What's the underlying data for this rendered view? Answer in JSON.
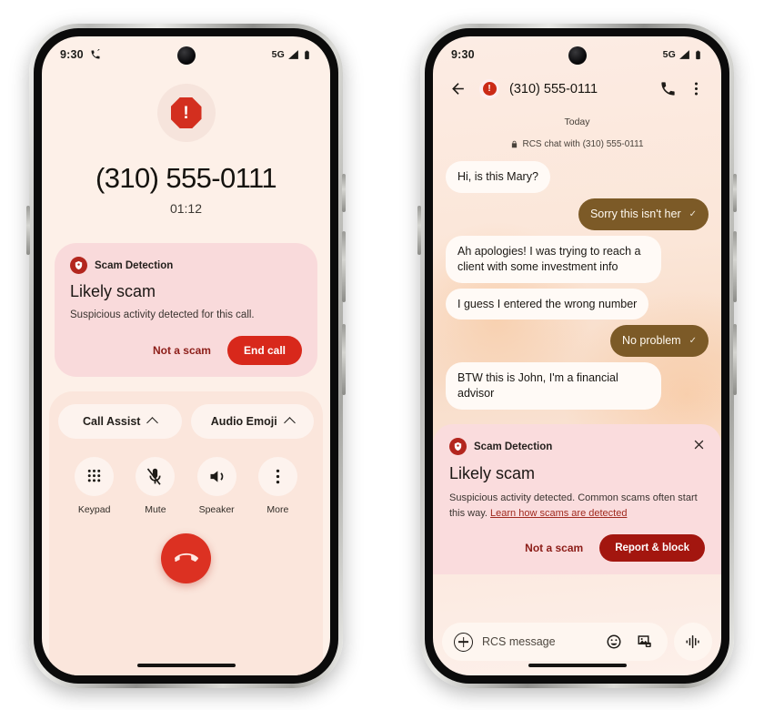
{
  "call_phone": {
    "status_bar": {
      "time": "9:30",
      "call_icon": "phone-active-icon",
      "network": "5G",
      "signal_icon": "signal-bars-icon",
      "battery_icon": "battery-icon"
    },
    "alert_icon": "octagon-alert-icon",
    "alert_glyph": "!",
    "caller_number": "(310) 555-0111",
    "call_duration": "01:12",
    "scam_card": {
      "shield_icon": "shield-scam-icon",
      "header": "Scam Detection",
      "title": "Likely scam",
      "body": "Suspicious activity detected for this call.",
      "secondary_action": "Not a scam",
      "primary_action": "End call",
      "card_bg": "#f9dadb",
      "primary_color": "#d8281b"
    },
    "assist_pills": [
      {
        "label": "Call Assist",
        "chevron": "chevron-up-icon"
      },
      {
        "label": "Audio Emoji",
        "chevron": "chevron-up-icon"
      }
    ],
    "controls": [
      {
        "label": "Keypad",
        "icon": "keypad-icon"
      },
      {
        "label": "Mute",
        "icon": "mic-off-icon"
      },
      {
        "label": "Speaker",
        "icon": "speaker-icon"
      },
      {
        "label": "More",
        "icon": "more-vertical-icon"
      }
    ],
    "end_call_icon": "hang-up-icon",
    "end_call_color": "#dc3122"
  },
  "chat_phone": {
    "status_bar": {
      "time": "9:30",
      "network": "5G",
      "signal_icon": "signal-bars-icon",
      "battery_icon": "battery-icon"
    },
    "app_bar": {
      "back_icon": "arrow-back-icon",
      "warning_icon": "alert-circle-icon",
      "warning_glyph": "!",
      "title": "(310) 555-0111",
      "call_icon": "phone-icon",
      "menu_icon": "more-vertical-icon"
    },
    "day_divider": "Today",
    "encryption_notice": "RCS chat with (310) 555-0111",
    "lock_icon": "lock-icon",
    "messages": [
      {
        "text": "Hi, is this Mary?",
        "side": "in"
      },
      {
        "text": "Sorry this isn't her",
        "side": "out",
        "status": "✓"
      },
      {
        "text": "Ah apologies! I was trying to reach a client with some investment info",
        "side": "in",
        "group": "top"
      },
      {
        "text": "I guess I entered the wrong number",
        "side": "in",
        "group": "bottom"
      },
      {
        "text": "No problem",
        "side": "out",
        "status": "✓"
      },
      {
        "text": "BTW this is John, I'm a financial advisor",
        "side": "in"
      }
    ],
    "scam_card": {
      "shield_icon": "shield-scam-icon",
      "header": "Scam Detection",
      "close_icon": "close-icon",
      "title": "Likely scam",
      "body": "Suspicious activity detected. Common scams often start this way. ",
      "link": "Learn how scams are detected",
      "secondary_action": "Not a scam",
      "primary_action": "Report & block",
      "card_bg": "#fadcdd",
      "primary_color": "#a3160f"
    },
    "composer": {
      "add_icon": "plus-icon",
      "placeholder": "RCS message",
      "emoji_icon": "emoji-icon",
      "gallery_icon": "gallery-icon",
      "voice_icon": "voice-waveform-icon"
    },
    "bubble_in_color": "#fffaf6",
    "bubble_out_color": "#7c5a27"
  }
}
